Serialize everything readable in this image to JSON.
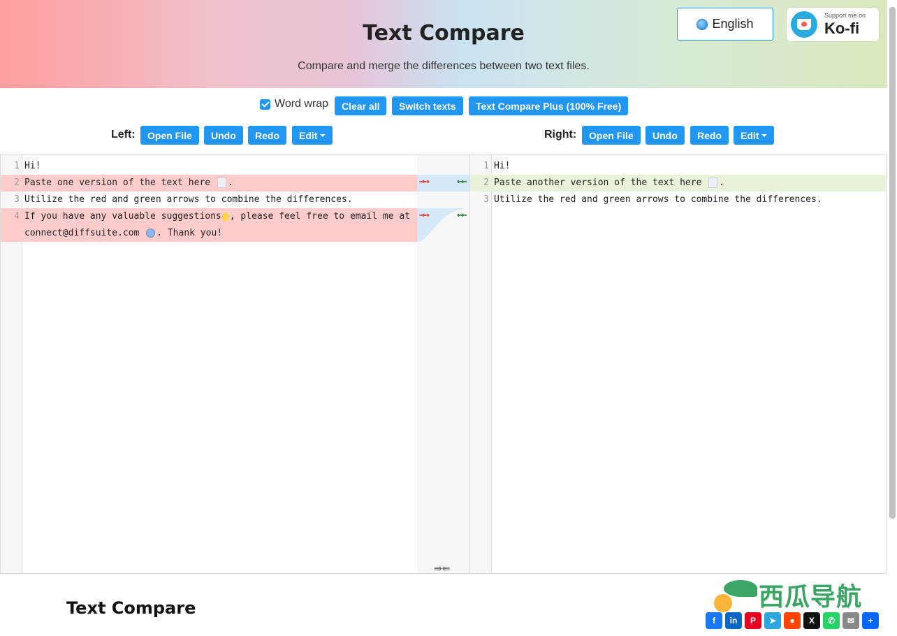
{
  "header": {
    "title": "Text Compare",
    "subtitle": "Compare and merge the differences between two text files.",
    "language": "English",
    "kofi_small": "Support me on",
    "kofi_big": "Ko-fi"
  },
  "toolbar": {
    "word_wrap_label": "Word wrap",
    "word_wrap_checked": true,
    "clear_all": "Clear all",
    "switch_texts": "Switch texts",
    "plus": "Text Compare Plus (100% Free)"
  },
  "left": {
    "label": "Left:",
    "open_file": "Open File",
    "undo": "Undo",
    "redo": "Redo",
    "edit": "Edit",
    "lines": [
      {
        "n": "1",
        "text": "Hi!"
      },
      {
        "n": "2",
        "text_a": "Paste one version of the text here ",
        "text_b": "."
      },
      {
        "n": "3",
        "text": "Utilize the red and green arrows to combine the differences."
      },
      {
        "n": "4",
        "text_a": "If you have any valuable suggestions",
        "text_b": ", please feel free to email me at connect@diffsuite.com ",
        "text_c": ". Thank you!"
      }
    ]
  },
  "right": {
    "label": "Right:",
    "open_file": "Open File",
    "undo": "Undo",
    "redo": "Redo",
    "edit": "Edit",
    "lines": [
      {
        "n": "1",
        "text": "Hi!"
      },
      {
        "n": "2",
        "text_a": "Paste another version of the text here ",
        "text_b": "."
      },
      {
        "n": "3",
        "text": "Utilize the red and green arrows to combine the differences."
      }
    ]
  },
  "merge": {
    "arrow_right": "⇝⇝",
    "arrow_left": "⇜⇜",
    "merge_all": "⇛⇚"
  },
  "footer": {
    "title": "Text Compare",
    "watermark": "西瓜导航"
  },
  "share": [
    {
      "icon": "facebook-icon",
      "glyph": "f",
      "color": "#1877f2"
    },
    {
      "icon": "linkedin-icon",
      "glyph": "in",
      "color": "#0a66c2"
    },
    {
      "icon": "pinterest-icon",
      "glyph": "P",
      "color": "#e60023"
    },
    {
      "icon": "telegram-icon",
      "glyph": "➤",
      "color": "#2ca5e0"
    },
    {
      "icon": "reddit-icon",
      "glyph": "●",
      "color": "#ff4500"
    },
    {
      "icon": "x-icon",
      "glyph": "X",
      "color": "#111111"
    },
    {
      "icon": "whatsapp-icon",
      "glyph": "✆",
      "color": "#25d366"
    },
    {
      "icon": "email-icon",
      "glyph": "✉",
      "color": "#888888"
    },
    {
      "icon": "share-icon",
      "glyph": "+",
      "color": "#0166ff"
    }
  ],
  "colors": {
    "accent": "#2196f3",
    "deleted_line": "#ffcccc",
    "inserted_line": "#e9f3d9"
  }
}
